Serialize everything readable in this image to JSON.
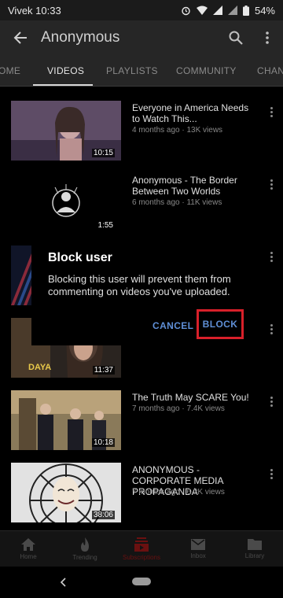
{
  "status_bar": {
    "carrier_time": "Vivek 10:33",
    "battery": "54%"
  },
  "app_bar": {
    "title": "Anonymous"
  },
  "tabs": [
    {
      "label": "OME",
      "active": false
    },
    {
      "label": "VIDEOS",
      "active": true
    },
    {
      "label": "PLAYLISTS",
      "active": false
    },
    {
      "label": "COMMUNITY",
      "active": false
    },
    {
      "label": "CHAN",
      "active": false
    }
  ],
  "videos": [
    {
      "title": "Everyone in America Needs to Watch This...",
      "meta": "4 months ago · 13K views",
      "duration": "10:15"
    },
    {
      "title": "Anonymous - The Border Between Two Worlds",
      "meta": "6 months ago · 11K views",
      "duration": "1:55"
    },
    {
      "title": "",
      "meta": "",
      "duration": ""
    },
    {
      "title": "",
      "meta": "",
      "duration": "11:37"
    },
    {
      "title": "The Truth May SCARE You!",
      "meta": "7 months ago · 7.4K views",
      "duration": "10:18"
    },
    {
      "title": "ANONYMOUS - CORPORATE MEDIA PROPAGANDA",
      "meta": "7 months ago · 6.2K views",
      "duration": "38:06"
    }
  ],
  "thumb_overlay_text": "DAYA",
  "dialog": {
    "title": "Block user",
    "body": "Blocking this user will prevent them from commenting on videos you've uploaded.",
    "cancel_label": "CANCEL",
    "block_label": "BLOCK"
  },
  "bottom_nav": [
    {
      "label": "Home",
      "icon": "home-icon",
      "active": false
    },
    {
      "label": "Trending",
      "icon": "flame-icon",
      "active": false
    },
    {
      "label": "Subscriptions",
      "icon": "subscriptions-icon",
      "active": true
    },
    {
      "label": "Inbox",
      "icon": "mail-icon",
      "active": false
    },
    {
      "label": "Library",
      "icon": "folder-icon",
      "active": false
    }
  ],
  "colors": {
    "accent_blue": "#5f8fd6",
    "highlight_red": "#d8202a",
    "active_nav_red": "#6a1010"
  }
}
